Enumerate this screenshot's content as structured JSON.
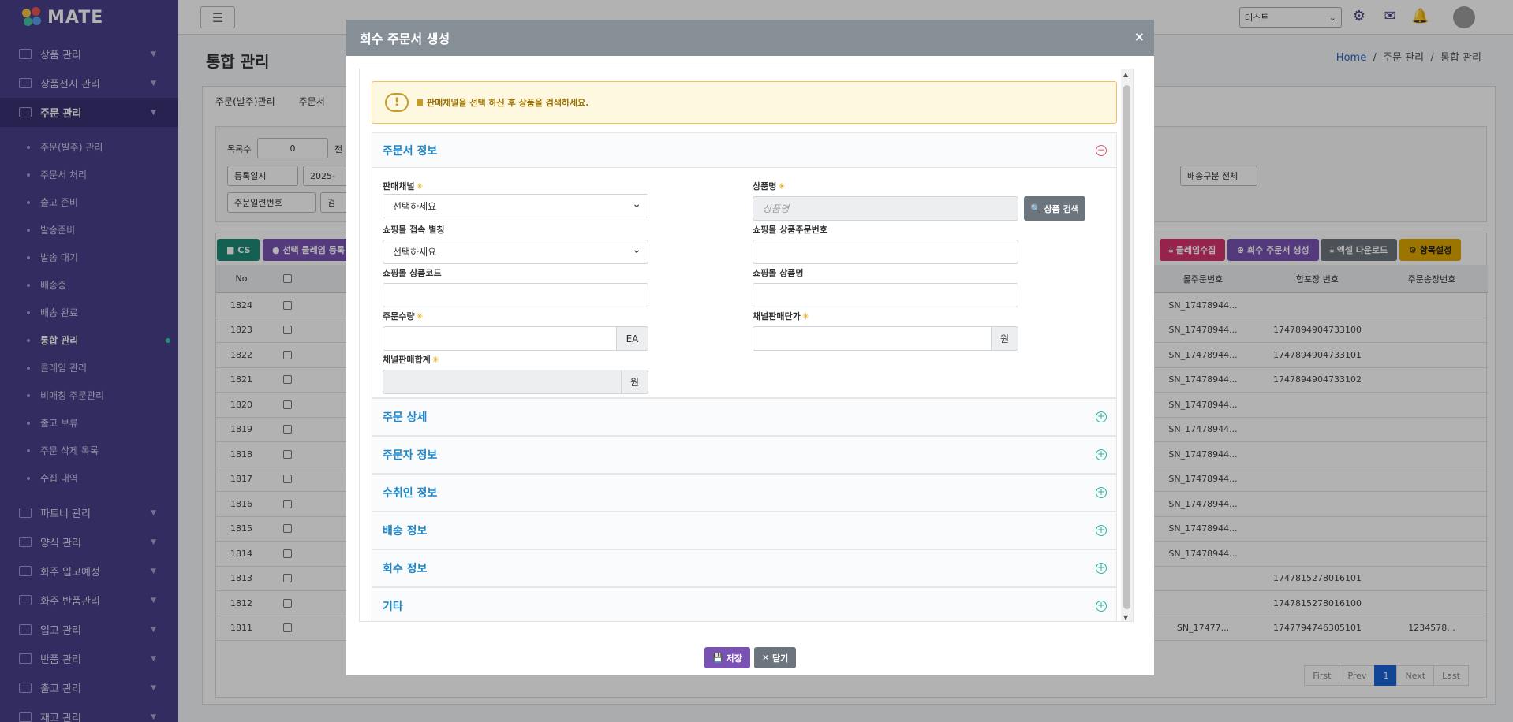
{
  "app": {
    "logo": "MATE"
  },
  "sidebar": {
    "menu": [
      {
        "label": "상품 관리"
      },
      {
        "label": "상품전시 관리"
      },
      {
        "label": "주문 관리"
      }
    ],
    "order_sub": [
      {
        "label": "주문(발주) 관리"
      },
      {
        "label": "주문서 처리"
      },
      {
        "label": "출고 준비"
      },
      {
        "label": "발송준비"
      },
      {
        "label": "발송 대기"
      },
      {
        "label": "배송중"
      },
      {
        "label": "배송 완료"
      },
      {
        "label": "통합 관리"
      },
      {
        "label": "클레임 관리"
      },
      {
        "label": "비매칭 주문관리"
      },
      {
        "label": "출고 보류"
      },
      {
        "label": "주문 삭제 목록"
      },
      {
        "label": "수집 내역"
      }
    ],
    "menu2": [
      {
        "label": "파트너 관리"
      },
      {
        "label": "양식 관리"
      },
      {
        "label": "화주 입고예정"
      },
      {
        "label": "화주 반품관리"
      },
      {
        "label": "입고 관리"
      },
      {
        "label": "반품 관리"
      },
      {
        "label": "출고 관리"
      },
      {
        "label": "재고 관리"
      }
    ]
  },
  "topbar": {
    "tenant": "테스트"
  },
  "page": {
    "title": "통합 관리",
    "breadcrumb": {
      "home": "Home",
      "sep": "/",
      "mid": "주문 관리",
      "current": "통합 관리"
    },
    "subtabs": [
      "주문(발주)관리",
      "주문서"
    ],
    "filters": {
      "count_label": "목록수",
      "count_value": "0",
      "extra_label": "전",
      "date_type": "등록일시",
      "date_value": "2025-",
      "ship_type": "배송구분 전체",
      "serial_type": "주문일련번호",
      "search_hint": "검"
    }
  },
  "grid": {
    "buttons": {
      "cs": "CS",
      "claim_reg": "선택 클레임 등록",
      "claim_collect": "클레임수집",
      "return_create": "회수 주문서 생성",
      "excel": "엑셀 다운로드",
      "columns": "항목설정"
    },
    "headers": {
      "no": "No",
      "mall_order_no": "몰주문번호",
      "pack_no": "합포장 번호",
      "invoice_no": "주문송장번호"
    },
    "rows": [
      {
        "no": "1824",
        "mall": "SN_17478944...",
        "pack": "",
        "invoice": ""
      },
      {
        "no": "1823",
        "mall": "SN_17478944...",
        "pack": "1747894904733100",
        "invoice": ""
      },
      {
        "no": "1822",
        "mall": "SN_17478944...",
        "pack": "1747894904733101",
        "invoice": ""
      },
      {
        "no": "1821",
        "mall": "SN_17478944...",
        "pack": "1747894904733102",
        "invoice": ""
      },
      {
        "no": "1820",
        "mall": "SN_17478944...",
        "pack": "",
        "invoice": ""
      },
      {
        "no": "1819",
        "mall": "SN_17478944...",
        "pack": "",
        "invoice": ""
      },
      {
        "no": "1818",
        "mall": "SN_17478944...",
        "pack": "",
        "invoice": ""
      },
      {
        "no": "1817",
        "mall": "SN_17478944...",
        "pack": "",
        "invoice": ""
      },
      {
        "no": "1816",
        "mall": "SN_17478944...",
        "pack": "",
        "invoice": ""
      },
      {
        "no": "1815",
        "mall": "SN_17478944...",
        "pack": "",
        "invoice": ""
      },
      {
        "no": "1814",
        "mall": "SN_17478944...",
        "pack": "",
        "invoice": ""
      },
      {
        "no": "1813",
        "mall": "",
        "pack": "1747815278016101",
        "invoice": ""
      },
      {
        "no": "1812",
        "mall": "",
        "pack": "1747815278016100",
        "invoice": ""
      },
      {
        "no": "1811",
        "mall": "SN_17477...",
        "pack": "1747794746305101",
        "invoice": "1234578..."
      }
    ],
    "pager": {
      "first": "First",
      "prev": "Prev",
      "current": "1",
      "next": "Next",
      "last": "Last"
    }
  },
  "modal": {
    "title": "회수 주문서 생성",
    "close": "×",
    "alert": "판매채널을 선택 하신 후 상품을 검색하세요.",
    "sections": {
      "order_info": "주문서 정보",
      "order_detail": "주문 상세",
      "orderer": "주문자 정보",
      "receiver": "수취인 정보",
      "shipping": "배송 정보",
      "return_info": "회수 정보",
      "etc": "기타"
    },
    "form": {
      "sales_channel": {
        "label": "판매채널",
        "value": "선택하세요"
      },
      "product_name": {
        "label": "상품명",
        "placeholder": "상품명",
        "button": "상품 검색"
      },
      "mall_alias": {
        "label": "쇼핑몰 접속 별칭",
        "value": "선택하세요"
      },
      "mall_product_order_no": {
        "label": "쇼핑몰 상품주문번호"
      },
      "mall_product_code": {
        "label": "쇼핑몰 상품코드"
      },
      "mall_product_name": {
        "label": "쇼핑몰 상품명"
      },
      "order_qty": {
        "label": "주문수량",
        "unit": "EA"
      },
      "channel_unit_price": {
        "label": "채널판매단가",
        "unit": "원"
      },
      "channel_total": {
        "label": "채널판매합계",
        "unit": "원"
      }
    },
    "footer": {
      "save": "저장",
      "close": "닫기"
    }
  }
}
